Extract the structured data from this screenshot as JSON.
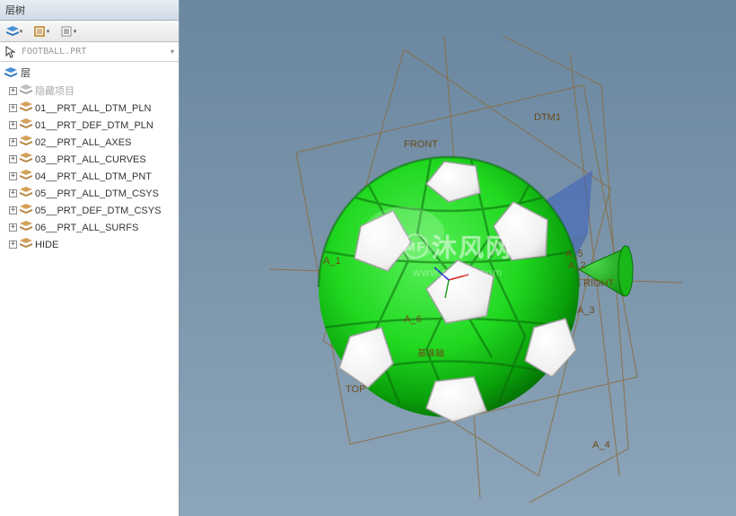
{
  "sidebar": {
    "title": "层树",
    "filename": "FOOTBALL.PRT",
    "root_label": "层",
    "items": [
      {
        "label": "隐藏项目",
        "disabled": true
      },
      {
        "label": "01__PRT_ALL_DTM_PLN",
        "disabled": false
      },
      {
        "label": "01__PRT_DEF_DTM_PLN",
        "disabled": false
      },
      {
        "label": "02__PRT_ALL_AXES",
        "disabled": false
      },
      {
        "label": "03__PRT_ALL_CURVES",
        "disabled": false
      },
      {
        "label": "04__PRT_ALL_DTM_PNT",
        "disabled": false
      },
      {
        "label": "05__PRT_ALL_DTM_CSYS",
        "disabled": false
      },
      {
        "label": "05__PRT_DEF_DTM_CSYS",
        "disabled": false
      },
      {
        "label": "06__PRT_ALL_SURFS",
        "disabled": false
      },
      {
        "label": "HIDE",
        "disabled": false
      }
    ]
  },
  "viewport": {
    "datums": {
      "front": "FRONT",
      "top": "TOP",
      "right": "RIGHT",
      "dtm1": "DTM1",
      "a1": "A_1",
      "a2": "A_2",
      "a3": "A_3",
      "a4": "A_4",
      "a5": "A_5",
      "a6": "A_6",
      "csys_label": "基准轴"
    }
  },
  "watermark": {
    "brand": "沐风网",
    "url": "www.mfcad.com"
  }
}
